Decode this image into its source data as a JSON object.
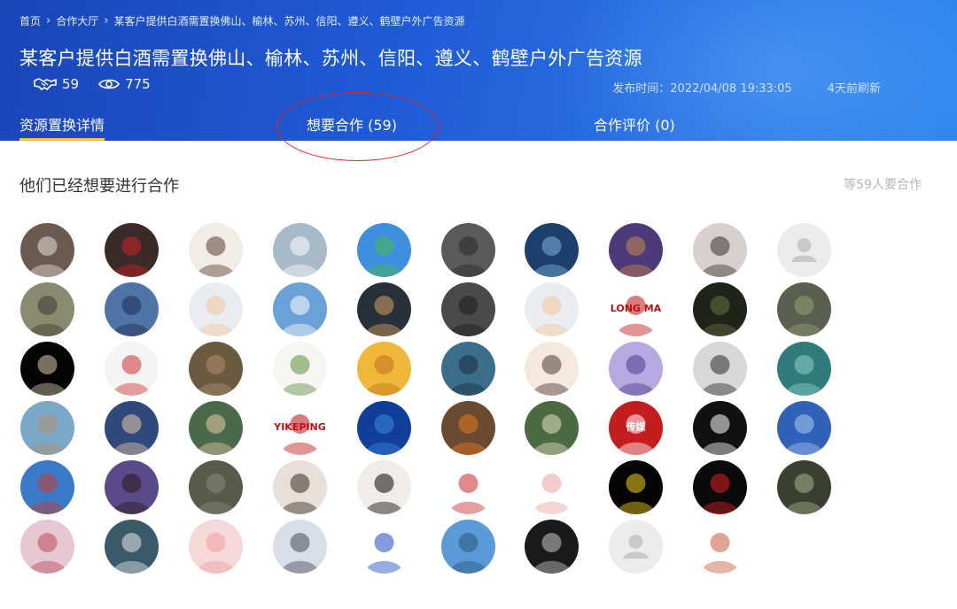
{
  "breadcrumb": {
    "home": "首页",
    "hall": "合作大厅",
    "current": "某客户提供白酒需置换佛山、榆林、苏州、信阳、遵义、鹤壁户外广告资源"
  },
  "title": "某客户提供白酒需置换佛山、榆林、苏州、信阳、遵义、鹤壁户外广告资源",
  "stats": {
    "handshake_count": "59",
    "views_count": "775"
  },
  "meta": {
    "published": "发布时间：2022/04/08 19:33:05",
    "refreshed": "4天前刷新"
  },
  "tabs": [
    {
      "label": "资源置换详情",
      "active": true
    },
    {
      "label": "想要合作 (59)",
      "active": false
    },
    {
      "label": "合作评价 (0)",
      "active": false
    }
  ],
  "section": {
    "heading": "他们已经想要进行合作",
    "count_note": "等59人要合作"
  },
  "avatars": [
    {
      "bg": "#6a5a50",
      "accent": "#e8e0d8",
      "text": ""
    },
    {
      "bg": "#3a2a28",
      "accent": "#c22",
      "text": ""
    },
    {
      "bg": "#f2ece6",
      "accent": "#5a4030",
      "text": ""
    },
    {
      "bg": "#a8b9c8",
      "accent": "#ffffff",
      "text": ""
    },
    {
      "bg": "#3f8fe0",
      "accent": "#4fb84a",
      "text": ""
    },
    {
      "bg": "#5a5a5a",
      "accent": "#2a2a2a",
      "text": ""
    },
    {
      "bg": "#1d3f6c",
      "accent": "#7fb2e0",
      "text": ""
    },
    {
      "bg": "#4d3a7a",
      "accent": "#c88a4a",
      "text": ""
    },
    {
      "bg": "#d8d0cc",
      "accent": "#3a3030",
      "text": ""
    },
    {
      "bg": "#ececec",
      "accent": "#c9c9c9",
      "text": "",
      "placeholder": true
    },
    {
      "bg": "#8a8a70",
      "accent": "#3a3a30",
      "text": ""
    },
    {
      "bg": "#4f74a8",
      "accent": "#1d2d4a",
      "text": ""
    },
    {
      "bg": "#e9edf2",
      "accent": "#f3c79a",
      "text": ""
    },
    {
      "bg": "#6aa1d8",
      "accent": "#ffffff",
      "text": ""
    },
    {
      "bg": "#28303a",
      "accent": "#d7a060",
      "text": ""
    },
    {
      "bg": "#4a4a4a",
      "accent": "#1d1d1d",
      "text": ""
    },
    {
      "bg": "#e9edf2",
      "accent": "#f3c79a",
      "text": ""
    },
    {
      "bg": "#ffffff",
      "accent": "#b11",
      "text": "LONG MA"
    },
    {
      "bg": "#1f2418",
      "accent": "#6a7040",
      "text": ""
    },
    {
      "bg": "#5a6050",
      "accent": "#9aa070",
      "text": ""
    },
    {
      "bg": "#050505",
      "accent": "#d8c8b0",
      "text": ""
    },
    {
      "bg": "#f4f4f4",
      "accent": "#c33",
      "text": ""
    },
    {
      "bg": "#6a5a40",
      "accent": "#b09070",
      "text": ""
    },
    {
      "bg": "#f7f7f2",
      "accent": "#5a9040",
      "text": ""
    },
    {
      "bg": "#f0b838",
      "accent": "#c07020",
      "text": ""
    },
    {
      "bg": "#3a6e8a",
      "accent": "#1a3040",
      "text": ""
    },
    {
      "bg": "#f5e8dc",
      "accent": "#4a3a30",
      "text": ""
    },
    {
      "bg": "#b8a8e0",
      "accent": "#4a3a8a",
      "text": ""
    },
    {
      "bg": "#d8d8d8",
      "accent": "#2a2a2a",
      "text": ""
    },
    {
      "bg": "#2f7c7a",
      "accent": "#8fd0c8",
      "text": ""
    },
    {
      "bg": "#7aa8c8",
      "accent": "#b09070",
      "text": ""
    },
    {
      "bg": "#2f4a7a",
      "accent": "#e8c8a8",
      "text": ""
    },
    {
      "bg": "#4a6a4a",
      "accent": "#e8c8a8",
      "text": ""
    },
    {
      "bg": "#ffffff",
      "accent": "#b11",
      "text": "YIKEPING"
    },
    {
      "bg": "#0f3f9a",
      "accent": "#3a8ae0",
      "text": ""
    },
    {
      "bg": "#6a4a30",
      "accent": "#e87a20",
      "text": ""
    },
    {
      "bg": "#4a6a40",
      "accent": "#e8e0c8",
      "text": ""
    },
    {
      "bg": "#c41d1d",
      "accent": "#ffffff",
      "text": "传媒"
    },
    {
      "bg": "#111111",
      "accent": "#ffffff",
      "text": ""
    },
    {
      "bg": "#2f62b8",
      "accent": "#a8c8f0",
      "text": ""
    },
    {
      "bg": "#3a7ac8",
      "accent": "#c83a2a",
      "text": ""
    },
    {
      "bg": "#5a4a8a",
      "accent": "#2a1a1a",
      "text": ""
    },
    {
      "bg": "#5a5a4a",
      "accent": "#8a8a7a",
      "text": ""
    },
    {
      "bg": "#e8e0d8",
      "accent": "#3a2a20",
      "text": ""
    },
    {
      "bg": "#f0ece8",
      "accent": "#0a0a0a",
      "text": ""
    },
    {
      "bg": "#ffffff",
      "accent": "#c52a2a",
      "text": ""
    },
    {
      "bg": "#ffffff",
      "accent": "#e8a0a0",
      "text": ""
    },
    {
      "bg": "#050505",
      "accent": "#f5d020",
      "text": ""
    },
    {
      "bg": "#0a0a0a",
      "accent": "#d22",
      "text": ""
    },
    {
      "bg": "#3a4030",
      "accent": "#a8b090",
      "text": ""
    },
    {
      "bg": "#e8c8d0",
      "accent": "#b84a5a",
      "text": ""
    },
    {
      "bg": "#3a5a6a",
      "accent": "#e8e8e8",
      "text": ""
    },
    {
      "bg": "#f5d8d8",
      "accent": "#f0a0a0",
      "text": ""
    },
    {
      "bg": "#d8dfe8",
      "accent": "#4a4a5a",
      "text": ""
    },
    {
      "bg": "#ffffff",
      "accent": "#1a4ab8",
      "text": ""
    },
    {
      "bg": "#5a9ad8",
      "accent": "#2a5a7a",
      "text": ""
    },
    {
      "bg": "#1a1a1a",
      "accent": "#c8c8c8",
      "text": ""
    },
    {
      "bg": "#ececec",
      "accent": "#c9c9c9",
      "text": "",
      "placeholder": true
    },
    {
      "bg": "#ffffff",
      "accent": "#c85a3a",
      "text": ""
    }
  ]
}
